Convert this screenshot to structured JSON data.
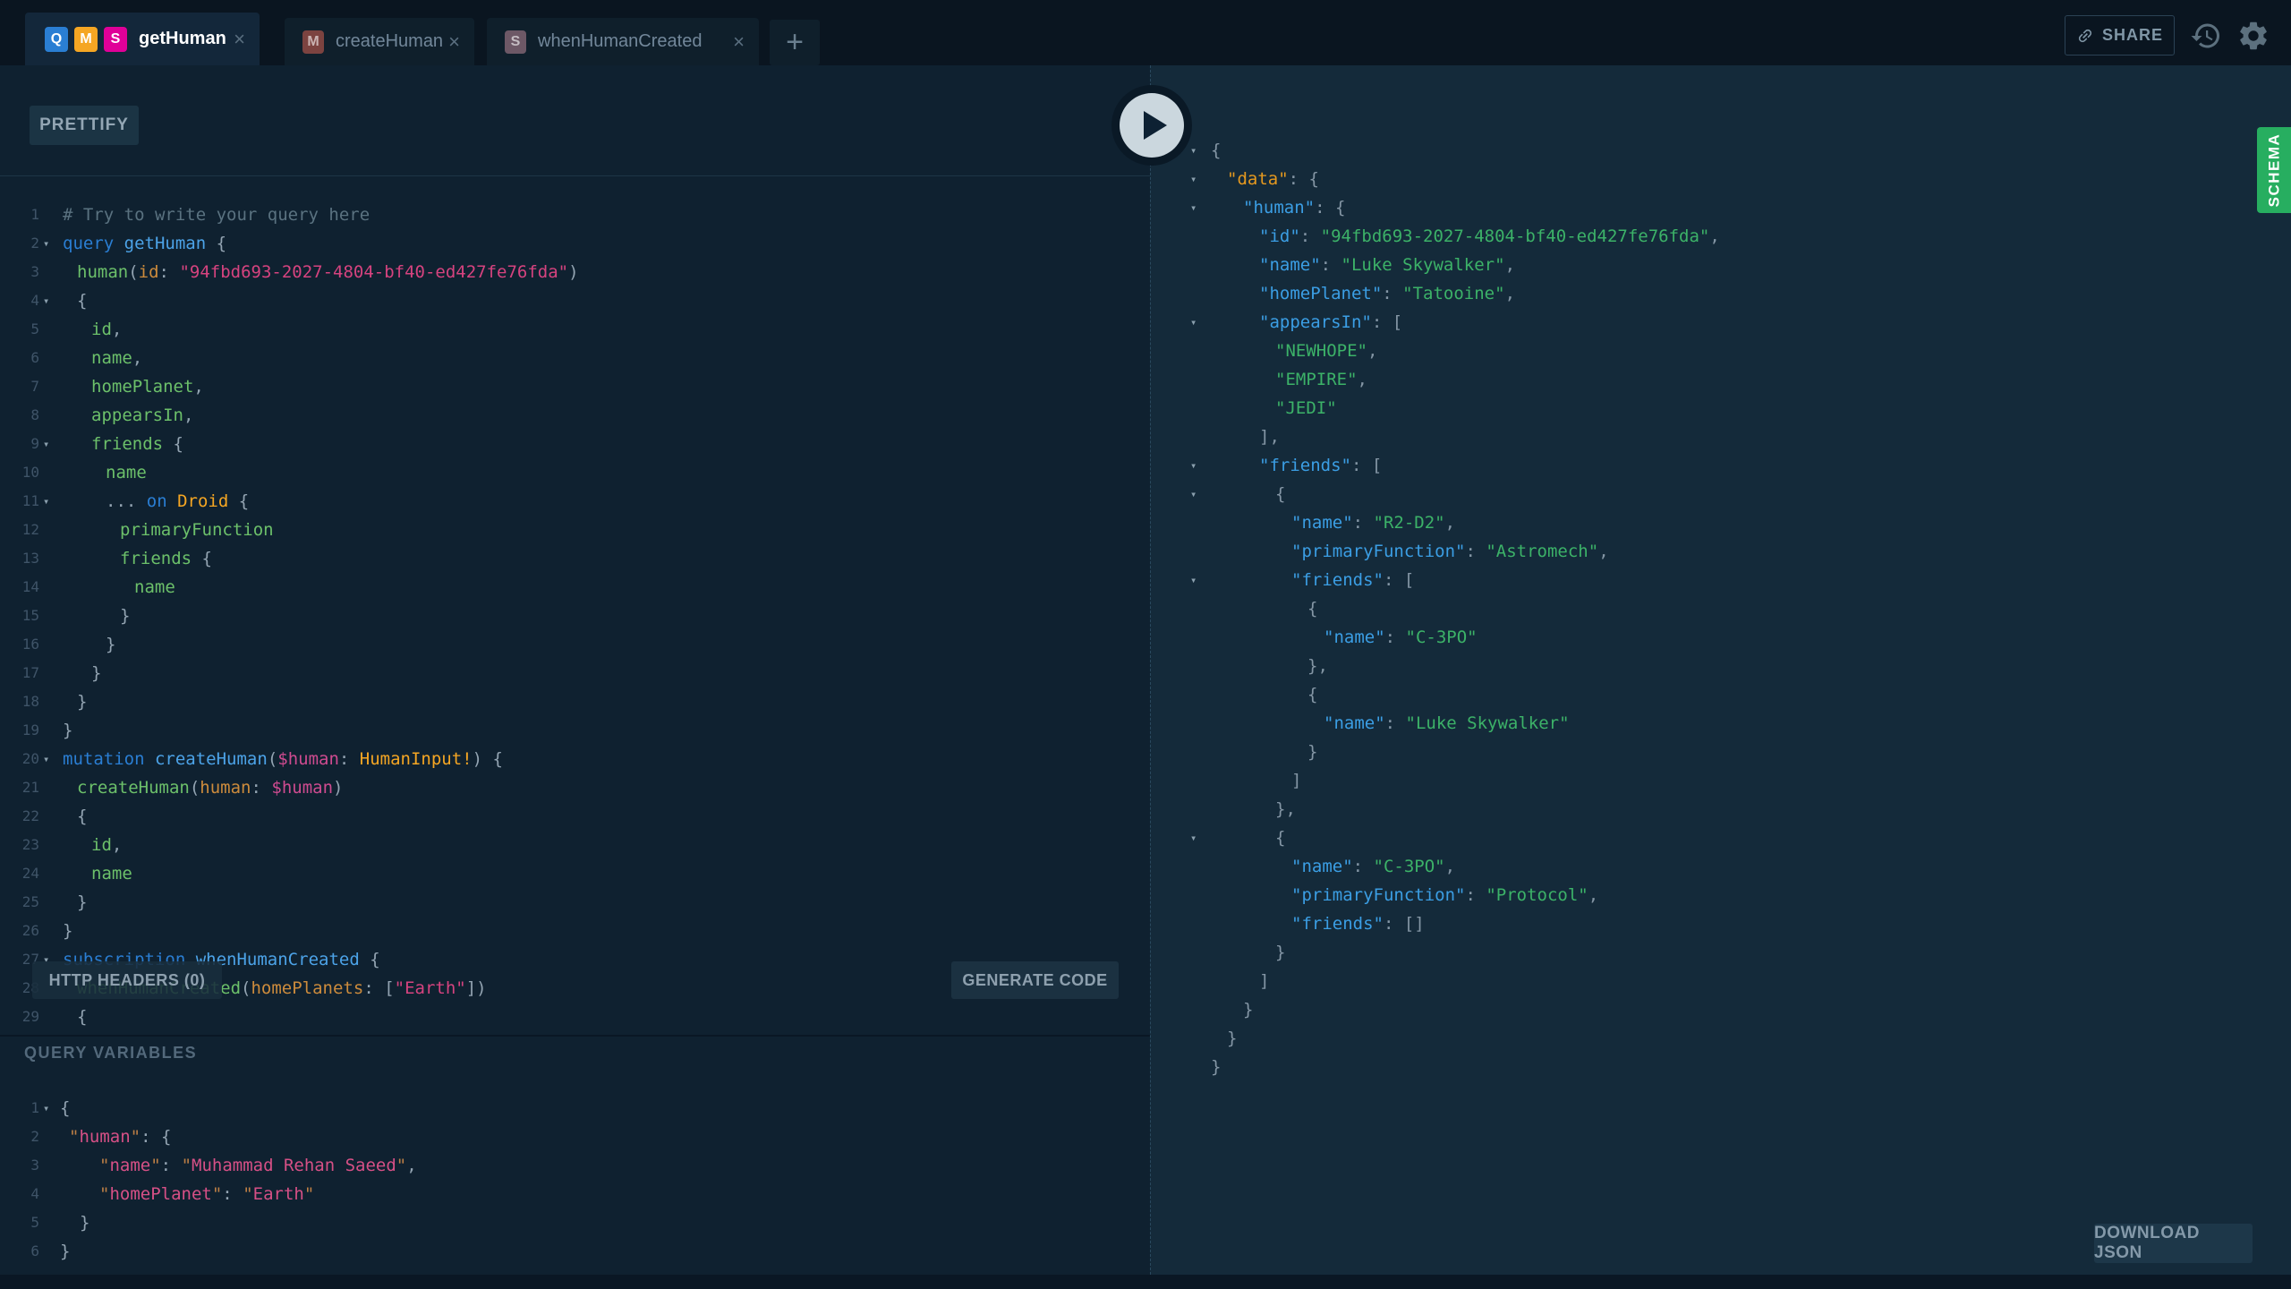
{
  "topbar": {
    "tabs": [
      {
        "label": "getHuman",
        "active": true,
        "badges": [
          {
            "letter": "Q"
          },
          {
            "letter": "M"
          },
          {
            "letter": "S"
          }
        ]
      },
      {
        "label": "createHuman",
        "active": false,
        "badges": [
          {
            "letter": "M"
          }
        ]
      },
      {
        "label": "whenHumanCreated",
        "active": false,
        "badges": [
          {
            "letter": "S"
          }
        ]
      }
    ],
    "share_label": "SHARE"
  },
  "icons": {
    "share": "link-icon",
    "history": "history-restore-icon",
    "settings": "gear-icon",
    "play": "play-icon",
    "close_glyph": "×",
    "add_glyph": "+",
    "fold_glyph": "▾"
  },
  "colors": {
    "query_badge": "#2a7ed3",
    "mutation_badge": "#f5a623",
    "subscription_badge": "#e00098",
    "mutation_badge_inactive": "#7c4340",
    "subscription_badge_inactive": "#6d5866",
    "schema_green": "#27ae60"
  },
  "editor": {
    "prettify_label": "PRETTIFY",
    "http_headers_label": "HTTP HEADERS (0)",
    "generate_code_label": "GENERATE CODE",
    "lines": [
      {
        "n": 1,
        "i": 0,
        "t": [
          [
            "c",
            "# Try to write your query here"
          ]
        ]
      },
      {
        "n": 2,
        "i": 0,
        "f": true,
        "t": [
          [
            "k",
            "query"
          ],
          [
            "x",
            " "
          ],
          [
            "d",
            "getHuman"
          ],
          [
            "x",
            " {"
          ]
        ]
      },
      {
        "n": 3,
        "i": 16,
        "t": [
          [
            "p",
            "human"
          ],
          [
            "x",
            "("
          ],
          [
            "a",
            "id"
          ],
          [
            "x",
            ": "
          ],
          [
            "s",
            "\"94fbd693-2027-4804-bf40-ed427fe76fda\""
          ],
          [
            "x",
            ")"
          ]
        ]
      },
      {
        "n": 4,
        "i": 16,
        "f": true,
        "t": [
          [
            "x",
            "{"
          ]
        ]
      },
      {
        "n": 5,
        "i": 32,
        "t": [
          [
            "p",
            "id"
          ],
          [
            "x",
            ","
          ]
        ]
      },
      {
        "n": 6,
        "i": 32,
        "t": [
          [
            "p",
            "name"
          ],
          [
            "x",
            ","
          ]
        ]
      },
      {
        "n": 7,
        "i": 32,
        "t": [
          [
            "p",
            "homePlanet"
          ],
          [
            "x",
            ","
          ]
        ]
      },
      {
        "n": 8,
        "i": 32,
        "t": [
          [
            "p",
            "appearsIn"
          ],
          [
            "x",
            ","
          ]
        ]
      },
      {
        "n": 9,
        "i": 32,
        "f": true,
        "t": [
          [
            "p",
            "friends"
          ],
          [
            "x",
            " {"
          ]
        ]
      },
      {
        "n": 10,
        "i": 48,
        "t": [
          [
            "p",
            "name"
          ]
        ]
      },
      {
        "n": 11,
        "i": 48,
        "f": true,
        "t": [
          [
            "x",
            "... "
          ],
          [
            "k",
            "on"
          ],
          [
            "x",
            " "
          ],
          [
            "t",
            "Droid"
          ],
          [
            "x",
            " {"
          ]
        ]
      },
      {
        "n": 12,
        "i": 64,
        "t": [
          [
            "p",
            "primaryFunction"
          ]
        ]
      },
      {
        "n": 13,
        "i": 64,
        "t": [
          [
            "p",
            "friends"
          ],
          [
            "x",
            " {"
          ]
        ]
      },
      {
        "n": 14,
        "i": 80,
        "t": [
          [
            "p",
            "name"
          ]
        ]
      },
      {
        "n": 15,
        "i": 64,
        "t": [
          [
            "x",
            "}"
          ]
        ]
      },
      {
        "n": 16,
        "i": 48,
        "t": [
          [
            "x",
            "}"
          ]
        ]
      },
      {
        "n": 17,
        "i": 32,
        "t": [
          [
            "x",
            "}"
          ]
        ]
      },
      {
        "n": 18,
        "i": 16,
        "t": [
          [
            "x",
            "}"
          ]
        ]
      },
      {
        "n": 19,
        "i": 0,
        "t": [
          [
            "x",
            "}"
          ]
        ]
      },
      {
        "n": 20,
        "i": 0,
        "f": true,
        "t": [
          [
            "k",
            "mutation"
          ],
          [
            "x",
            " "
          ],
          [
            "d",
            "createHuman"
          ],
          [
            "x",
            "("
          ],
          [
            "v",
            "$human"
          ],
          [
            "x",
            ": "
          ],
          [
            "t",
            "HumanInput!"
          ],
          [
            "x",
            ") {"
          ]
        ]
      },
      {
        "n": 21,
        "i": 16,
        "t": [
          [
            "p",
            "createHuman"
          ],
          [
            "x",
            "("
          ],
          [
            "a",
            "human"
          ],
          [
            "x",
            ": "
          ],
          [
            "v",
            "$human"
          ],
          [
            "x",
            ")"
          ]
        ]
      },
      {
        "n": 22,
        "i": 16,
        "t": [
          [
            "x",
            "{"
          ]
        ]
      },
      {
        "n": 23,
        "i": 32,
        "t": [
          [
            "p",
            "id"
          ],
          [
            "x",
            ","
          ]
        ]
      },
      {
        "n": 24,
        "i": 32,
        "t": [
          [
            "p",
            "name"
          ]
        ]
      },
      {
        "n": 25,
        "i": 16,
        "t": [
          [
            "x",
            "}"
          ]
        ]
      },
      {
        "n": 26,
        "i": 0,
        "t": [
          [
            "x",
            "}"
          ]
        ]
      },
      {
        "n": 27,
        "i": 0,
        "f": true,
        "t": [
          [
            "k",
            "subscription"
          ],
          [
            "x",
            " "
          ],
          [
            "d",
            "whenHumanCreated"
          ],
          [
            "x",
            " {"
          ]
        ]
      },
      {
        "n": 28,
        "i": 16,
        "t": [
          [
            "p",
            "whenHumanCreated"
          ],
          [
            "x",
            "("
          ],
          [
            "a",
            "homePlanets"
          ],
          [
            "x",
            ": ["
          ],
          [
            "s",
            "\"Earth\""
          ],
          [
            "x",
            "])"
          ]
        ]
      },
      {
        "n": 29,
        "i": 16,
        "t": [
          [
            "x",
            "{"
          ]
        ]
      }
    ]
  },
  "variables": {
    "header": "QUERY VARIABLES",
    "lines": [
      {
        "n": 1,
        "i": 0,
        "f": true,
        "t": [
          [
            "x",
            "{"
          ]
        ]
      },
      {
        "n": 2,
        "i": 10,
        "t": [
          [
            "q",
            "\""
          ],
          [
            "vs",
            "human"
          ],
          [
            "q",
            "\""
          ],
          [
            "x",
            ": {"
          ]
        ]
      },
      {
        "n": 3,
        "i": 44,
        "t": [
          [
            "q",
            "\""
          ],
          [
            "vs",
            "name"
          ],
          [
            "q",
            "\""
          ],
          [
            "x",
            ": "
          ],
          [
            "q",
            "\""
          ],
          [
            "vs",
            "Muhammad Rehan Saeed"
          ],
          [
            "q",
            "\""
          ],
          [
            "x",
            ","
          ]
        ]
      },
      {
        "n": 4,
        "i": 44,
        "t": [
          [
            "q",
            "\""
          ],
          [
            "vs",
            "homePlanet"
          ],
          [
            "q",
            "\""
          ],
          [
            "x",
            ": "
          ],
          [
            "q",
            "\""
          ],
          [
            "vs",
            "Earth"
          ],
          [
            "q",
            "\""
          ]
        ]
      },
      {
        "n": 5,
        "i": 22,
        "t": [
          [
            "x",
            "}"
          ]
        ]
      },
      {
        "n": 6,
        "i": 0,
        "t": [
          [
            "x",
            "}"
          ]
        ]
      }
    ]
  },
  "results": {
    "download_label": "DOWNLOAD JSON",
    "schema_label": "SCHEMA",
    "lines": [
      {
        "i": 0,
        "f": true,
        "t": [
          [
            "rx",
            "{"
          ]
        ]
      },
      {
        "i": 18,
        "f": true,
        "t": [
          [
            "rd",
            "\"data\""
          ],
          [
            "rx",
            ": {"
          ]
        ]
      },
      {
        "i": 36,
        "f": true,
        "t": [
          [
            "rk",
            "\"human\""
          ],
          [
            "rx",
            ": {"
          ]
        ]
      },
      {
        "i": 54,
        "t": [
          [
            "rk",
            "\"id\""
          ],
          [
            "rx",
            ": "
          ],
          [
            "rs",
            "\"94fbd693-2027-4804-bf40-ed427fe76fda\""
          ],
          [
            "rx",
            ","
          ]
        ]
      },
      {
        "i": 54,
        "t": [
          [
            "rk",
            "\"name\""
          ],
          [
            "rx",
            ": "
          ],
          [
            "rs",
            "\"Luke Skywalker\""
          ],
          [
            "rx",
            ","
          ]
        ]
      },
      {
        "i": 54,
        "t": [
          [
            "rk",
            "\"homePlanet\""
          ],
          [
            "rx",
            ": "
          ],
          [
            "rs",
            "\"Tatooine\""
          ],
          [
            "rx",
            ","
          ]
        ]
      },
      {
        "i": 54,
        "f": true,
        "t": [
          [
            "rk",
            "\"appearsIn\""
          ],
          [
            "rx",
            ": ["
          ]
        ]
      },
      {
        "i": 72,
        "t": [
          [
            "rs",
            "\"NEWHOPE\""
          ],
          [
            "rx",
            ","
          ]
        ]
      },
      {
        "i": 72,
        "t": [
          [
            "rs",
            "\"EMPIRE\""
          ],
          [
            "rx",
            ","
          ]
        ]
      },
      {
        "i": 72,
        "t": [
          [
            "rs",
            "\"JEDI\""
          ]
        ]
      },
      {
        "i": 54,
        "t": [
          [
            "rx",
            "],"
          ]
        ]
      },
      {
        "i": 54,
        "f": true,
        "t": [
          [
            "rk",
            "\"friends\""
          ],
          [
            "rx",
            ": ["
          ]
        ]
      },
      {
        "i": 72,
        "f": true,
        "t": [
          [
            "rx",
            "{"
          ]
        ]
      },
      {
        "i": 90,
        "t": [
          [
            "rk",
            "\"name\""
          ],
          [
            "rx",
            ": "
          ],
          [
            "rs",
            "\"R2-D2\""
          ],
          [
            "rx",
            ","
          ]
        ]
      },
      {
        "i": 90,
        "t": [
          [
            "rk",
            "\"primaryFunction\""
          ],
          [
            "rx",
            ": "
          ],
          [
            "rs",
            "\"Astromech\""
          ],
          [
            "rx",
            ","
          ]
        ]
      },
      {
        "i": 90,
        "f": true,
        "t": [
          [
            "rk",
            "\"friends\""
          ],
          [
            "rx",
            ": ["
          ]
        ]
      },
      {
        "i": 108,
        "t": [
          [
            "rx",
            "{"
          ]
        ]
      },
      {
        "i": 126,
        "t": [
          [
            "rk",
            "\"name\""
          ],
          [
            "rx",
            ": "
          ],
          [
            "rs",
            "\"C-3PO\""
          ]
        ]
      },
      {
        "i": 108,
        "t": [
          [
            "rx",
            "},"
          ]
        ]
      },
      {
        "i": 108,
        "t": [
          [
            "rx",
            "{"
          ]
        ]
      },
      {
        "i": 126,
        "t": [
          [
            "rk",
            "\"name\""
          ],
          [
            "rx",
            ": "
          ],
          [
            "rs",
            "\"Luke Skywalker\""
          ]
        ]
      },
      {
        "i": 108,
        "t": [
          [
            "rx",
            "}"
          ]
        ]
      },
      {
        "i": 90,
        "t": [
          [
            "rx",
            "]"
          ]
        ]
      },
      {
        "i": 72,
        "t": [
          [
            "rx",
            "},"
          ]
        ]
      },
      {
        "i": 72,
        "f": true,
        "t": [
          [
            "rx",
            "{"
          ]
        ]
      },
      {
        "i": 90,
        "t": [
          [
            "rk",
            "\"name\""
          ],
          [
            "rx",
            ": "
          ],
          [
            "rs",
            "\"C-3PO\""
          ],
          [
            "rx",
            ","
          ]
        ]
      },
      {
        "i": 90,
        "t": [
          [
            "rk",
            "\"primaryFunction\""
          ],
          [
            "rx",
            ": "
          ],
          [
            "rs",
            "\"Protocol\""
          ],
          [
            "rx",
            ","
          ]
        ]
      },
      {
        "i": 90,
        "t": [
          [
            "rk",
            "\"friends\""
          ],
          [
            "rx",
            ": []"
          ]
        ]
      },
      {
        "i": 72,
        "t": [
          [
            "rx",
            "}"
          ]
        ]
      },
      {
        "i": 54,
        "t": [
          [
            "rx",
            "]"
          ]
        ]
      },
      {
        "i": 36,
        "t": [
          [
            "rx",
            "}"
          ]
        ]
      },
      {
        "i": 18,
        "t": [
          [
            "rx",
            "}"
          ]
        ]
      },
      {
        "i": 0,
        "t": [
          [
            "rx",
            "}"
          ]
        ]
      }
    ]
  }
}
